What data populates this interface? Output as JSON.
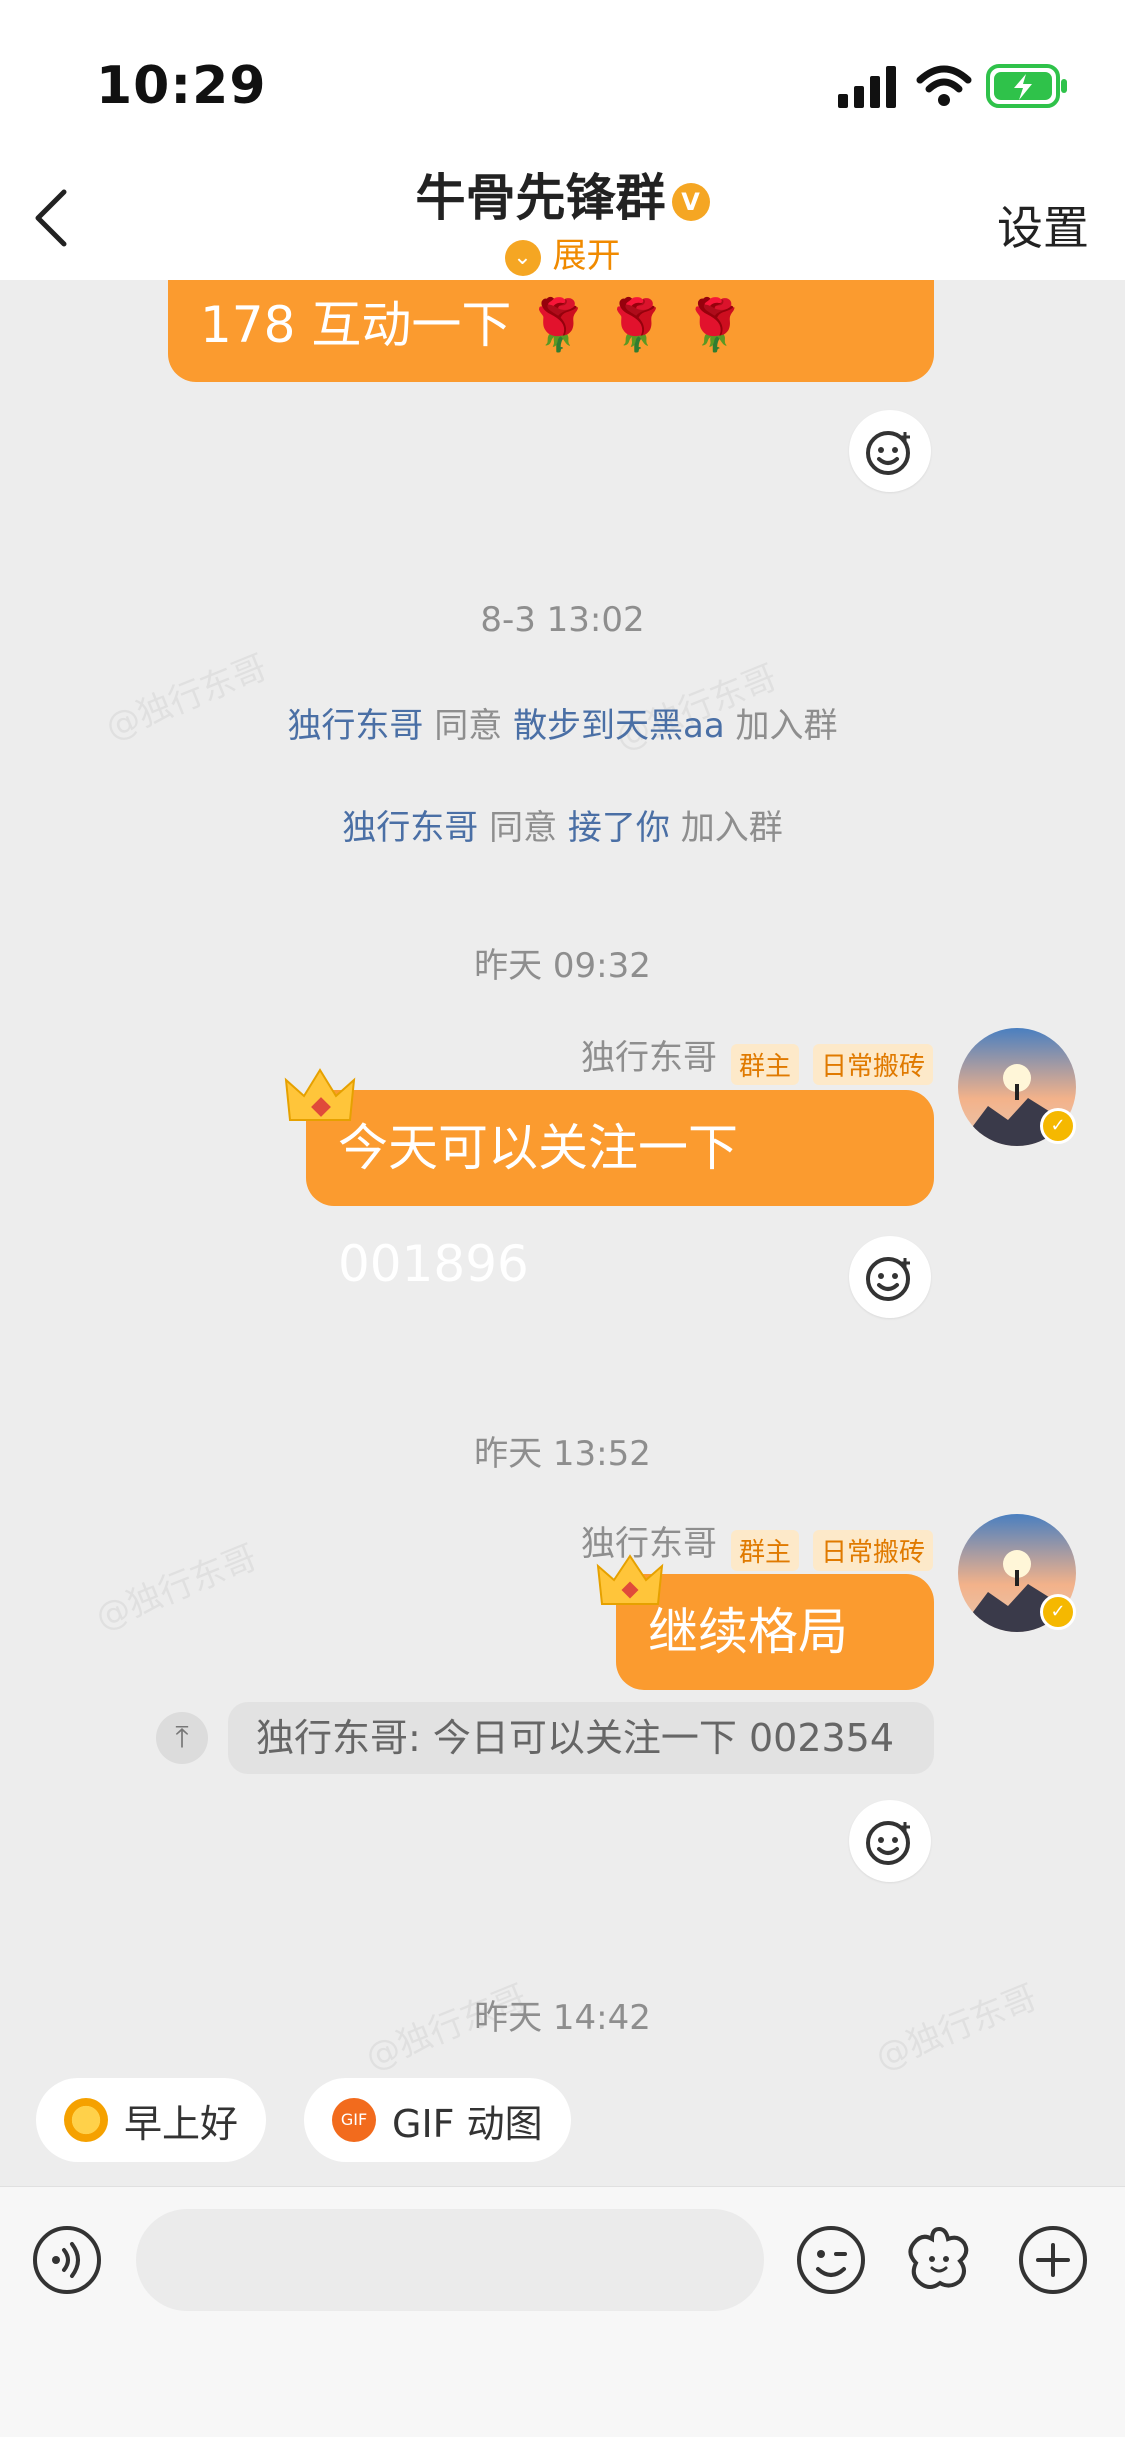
{
  "status_bar": {
    "time": "10:29"
  },
  "header": {
    "title": "牛骨先锋群",
    "expand_label": "展开",
    "settings_label": "设置",
    "verified_mark": "V"
  },
  "messages": {
    "partial_first_line": "178 互动一下 🌹 🌹 🌹",
    "ts1": "8-3 13:02",
    "sys1": {
      "actor": "独行东哥",
      "verb": "同意",
      "target": "散步到天黑aa",
      "suffix": "加入群"
    },
    "sys2": {
      "actor": "独行东哥",
      "verb": "同意",
      "target": "接了你",
      "suffix": "加入群"
    },
    "ts2": "昨天 09:32",
    "msg1": {
      "sender": "独行东哥",
      "tag_owner": "群主",
      "tag_title": "日常搬砖",
      "text": "今天可以关注一下 001896"
    },
    "ts3": "昨天 13:52",
    "msg2": {
      "sender": "独行东哥",
      "tag_owner": "群主",
      "tag_title": "日常搬砖",
      "text": "继续格局 🫴"
    },
    "pinned_quote": "独行东哥: 今日可以关注一下 002354",
    "ts4": "昨天 14:42"
  },
  "quick_replies": [
    {
      "label": "早上好",
      "icon": "sun-emoji-icon"
    },
    {
      "label": "GIF 动图",
      "icon": "gif-icon"
    }
  ],
  "watermark": "@独行东哥",
  "colors": {
    "accent": "#fb9b2f",
    "link": "#4a6fa5",
    "chat_bg": "#ededed"
  }
}
